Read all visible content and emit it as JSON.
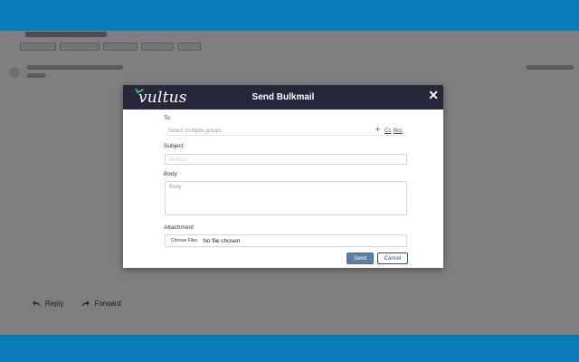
{
  "background": {
    "actions": [
      {
        "icon": "reply-icon",
        "label": "Reply"
      },
      {
        "icon": "forward-icon",
        "label": "Forward"
      }
    ]
  },
  "modal": {
    "brand": "vultus",
    "title": "Send Bulkmail",
    "close_icon": "close-icon",
    "to": {
      "label": "To",
      "placeholder": "Select multiple groups",
      "add_icon": "plus-icon",
      "cc": "Cc",
      "bcc": "Bcc"
    },
    "subject": {
      "label": "Subject",
      "placeholder": "Subject"
    },
    "body": {
      "label": "Body",
      "placeholder": "Body"
    },
    "attachment": {
      "label": "Attachment",
      "choose_label": "Choose Files",
      "status": "No file chosen"
    },
    "send_label": "Send",
    "cancel_label": "Cancel"
  },
  "colors": {
    "frame": "#0a7bb8",
    "header": "#26273a",
    "send": "#5b80a8",
    "link": "#1d4d9a"
  }
}
